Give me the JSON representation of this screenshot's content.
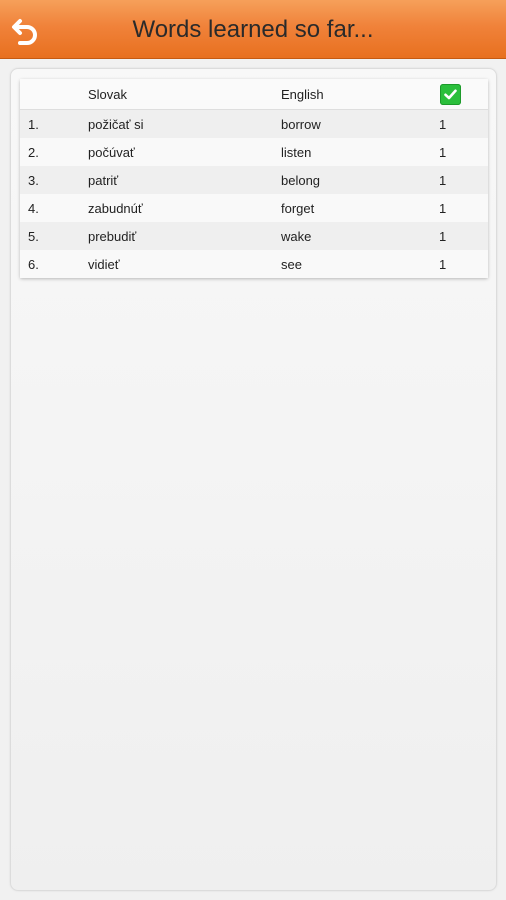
{
  "header": {
    "title": "Words learned so far...",
    "back_icon": "back-arrow-icon",
    "accent": "#f0823a"
  },
  "table": {
    "columns": {
      "slovak": "Slovak",
      "english": "English",
      "check_icon": "checkbox-checked-icon"
    },
    "rows": [
      {
        "num": "1.",
        "slovak": "požičať si",
        "english": "borrow",
        "count": "1"
      },
      {
        "num": "2.",
        "slovak": "počúvať",
        "english": "listen",
        "count": "1"
      },
      {
        "num": "3.",
        "slovak": "patriť",
        "english": "belong",
        "count": "1"
      },
      {
        "num": "4.",
        "slovak": "zabudnúť",
        "english": "forget",
        "count": "1"
      },
      {
        "num": "5.",
        "slovak": "prebudiť",
        "english": "wake",
        "count": "1"
      },
      {
        "num": "6.",
        "slovak": "vidieť",
        "english": "see",
        "count": "1"
      }
    ]
  }
}
